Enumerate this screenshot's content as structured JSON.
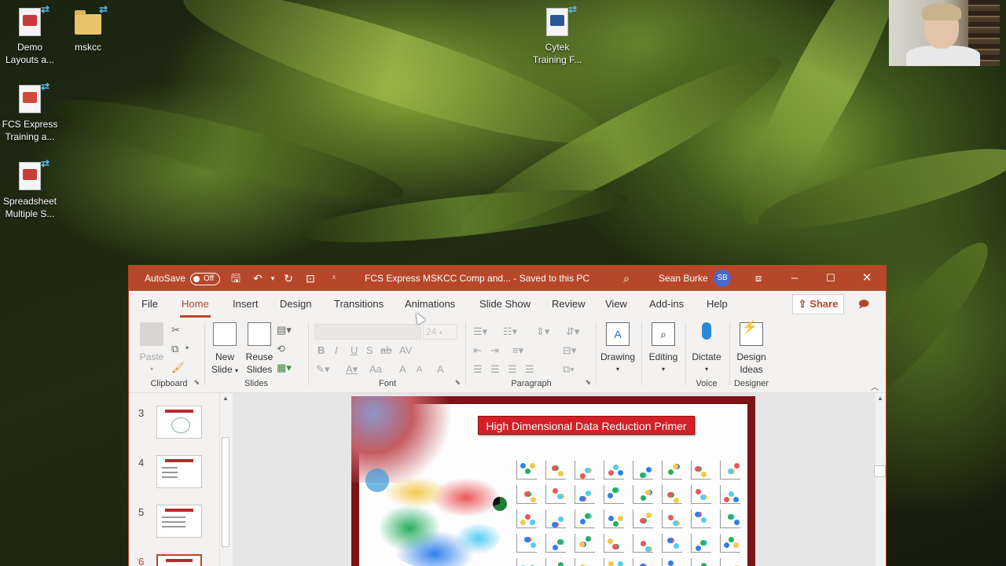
{
  "desktop": {
    "icons": [
      {
        "label": "Demo Layouts a...",
        "type": "pdf"
      },
      {
        "label": "mskcc",
        "type": "folder"
      },
      {
        "label": "Cytek Training F...",
        "type": "doc"
      },
      {
        "label": "FCS Express Training a...",
        "type": "pdf"
      },
      {
        "label": "Spreadsheet Multiple S...",
        "type": "pdf"
      }
    ]
  },
  "window": {
    "autosave_label": "AutoSave",
    "autosave_state": "Off",
    "title": "FCS Express MSKCC Comp and...  -  Saved to this PC",
    "user_name": "Sean Burke",
    "user_initials": "SB",
    "accent_color": "#b7472a"
  },
  "tabs": [
    "File",
    "Home",
    "Insert",
    "Design",
    "Transitions",
    "Animations",
    "Slide Show",
    "Review",
    "View",
    "Add-ins",
    "Help"
  ],
  "active_tab": "Home",
  "share_label": "Share",
  "ribbon": {
    "clipboard": {
      "name": "Clipboard",
      "paste": "Paste"
    },
    "slides": {
      "name": "Slides",
      "new_slide_1": "New",
      "new_slide_2": "Slide",
      "reuse_1": "Reuse",
      "reuse_2": "Slides"
    },
    "font": {
      "name": "Font",
      "font_size": "24",
      "bold": "B",
      "italic": "I",
      "underline": "U",
      "strike": "S",
      "strike2": "ab",
      "spacing": "AV",
      "grow": "A",
      "shrink": "A",
      "clear": "A",
      "case": "Aa"
    },
    "paragraph": {
      "name": "Paragraph"
    },
    "drawing": {
      "label": "Drawing"
    },
    "editing": {
      "label": "Editing"
    },
    "voice": {
      "name": "Voice",
      "dictate": "Dictate"
    },
    "designer": {
      "name": "Designer",
      "ideas_1": "Design",
      "ideas_2": "Ideas"
    }
  },
  "thumbnails": [
    {
      "num": "3",
      "selected": false
    },
    {
      "num": "4",
      "selected": false
    },
    {
      "num": "5",
      "selected": false
    },
    {
      "num": "6",
      "selected": true
    }
  ],
  "slide": {
    "title": "High Dimensional Data Reduction Primer"
  }
}
